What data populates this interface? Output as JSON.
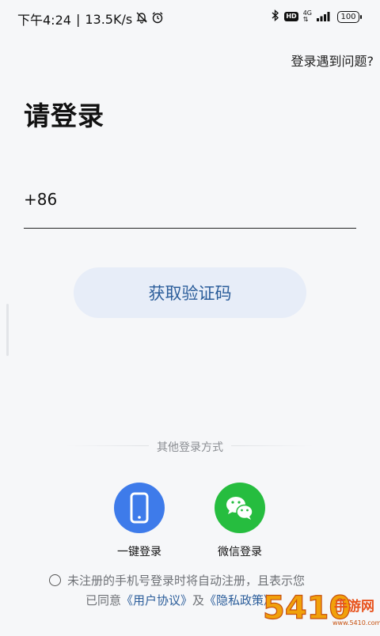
{
  "status_bar": {
    "time": "下午4:24",
    "separator": "|",
    "net_speed": "13.5K/s",
    "network_type": "4G",
    "hd_badge": "HD",
    "battery": "100"
  },
  "header": {
    "help_link": "登录遇到问题?",
    "title": "请登录"
  },
  "phone": {
    "country_code": "+86",
    "value": "",
    "placeholder": ""
  },
  "get_code_button": "获取验证码",
  "other_methods": {
    "label": "其他登录方式",
    "items": [
      {
        "label": "一键登录",
        "icon": "phone-icon",
        "color": "#3e7bea"
      },
      {
        "label": "微信登录",
        "icon": "wechat-icon",
        "color": "#26bd3f"
      }
    ]
  },
  "agreement": {
    "checked": false,
    "text_line1": "未注册的手机号登录时将自动注册，且表示您",
    "text_line2_prefix": "已同意",
    "user_agreement": "《用户协议》",
    "joiner": "及",
    "privacy_policy": "《隐私政策》"
  },
  "colors": {
    "background": "#f6f7f9",
    "accent": "#2b5d9a",
    "button_bg": "#e7edf8"
  },
  "watermark": {
    "text": "5410手游网",
    "url": "www.5410.com"
  }
}
